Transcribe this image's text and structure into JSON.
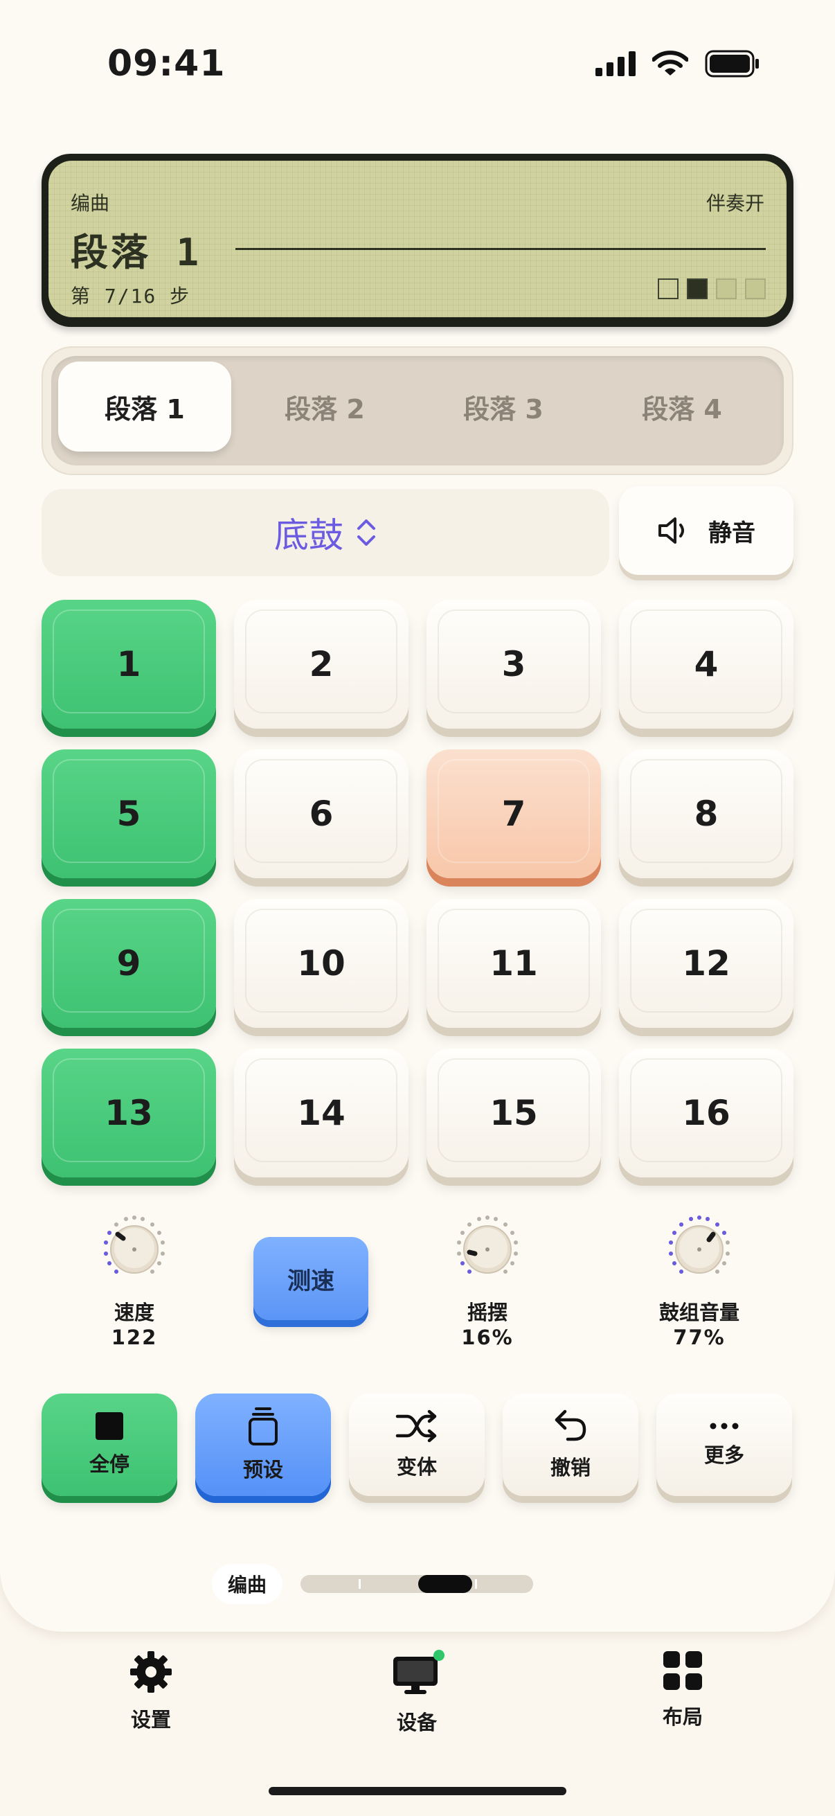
{
  "status": {
    "time": "09:41"
  },
  "lcd": {
    "mode": "编曲",
    "accompaniment": "伴奏开",
    "title": "段落 1",
    "step": "第 7/16 步"
  },
  "sections": [
    "段落 1",
    "段落 2",
    "段落 3",
    "段落 4"
  ],
  "instrument": {
    "label": "底鼓"
  },
  "mute": {
    "label": "静音"
  },
  "pads": [
    {
      "label": "1",
      "state": "on"
    },
    {
      "label": "2",
      "state": "off"
    },
    {
      "label": "3",
      "state": "off"
    },
    {
      "label": "4",
      "state": "off"
    },
    {
      "label": "5",
      "state": "on"
    },
    {
      "label": "6",
      "state": "off"
    },
    {
      "label": "7",
      "state": "current"
    },
    {
      "label": "8",
      "state": "off"
    },
    {
      "label": "9",
      "state": "on"
    },
    {
      "label": "10",
      "state": "off"
    },
    {
      "label": "11",
      "state": "off"
    },
    {
      "label": "12",
      "state": "off"
    },
    {
      "label": "13",
      "state": "on"
    },
    {
      "label": "14",
      "state": "off"
    },
    {
      "label": "15",
      "state": "off"
    },
    {
      "label": "16",
      "state": "off"
    }
  ],
  "knobs": {
    "tempo": {
      "label": "速度",
      "value": "122"
    },
    "swing": {
      "label": "摇摆",
      "value": "16%"
    },
    "kit_volume": {
      "label": "鼓组音量",
      "value": "77%"
    }
  },
  "tap_tempo": {
    "label": "测速"
  },
  "actions": {
    "stop_all": "全停",
    "presets": "预设",
    "variation": "变体",
    "undo": "撤销",
    "more": "更多"
  },
  "page_indicator": {
    "mode": "编曲"
  },
  "tabbar": {
    "settings": "设置",
    "device": "设备",
    "layout": "布局"
  },
  "colors": {
    "accent_purple": "#6a5be0",
    "pad_on_green": "#4ccb7c",
    "pad_current_peach": "#f9d3bb",
    "blue_button": "#6aa2fb",
    "lcd_green": "#d0d39f"
  }
}
